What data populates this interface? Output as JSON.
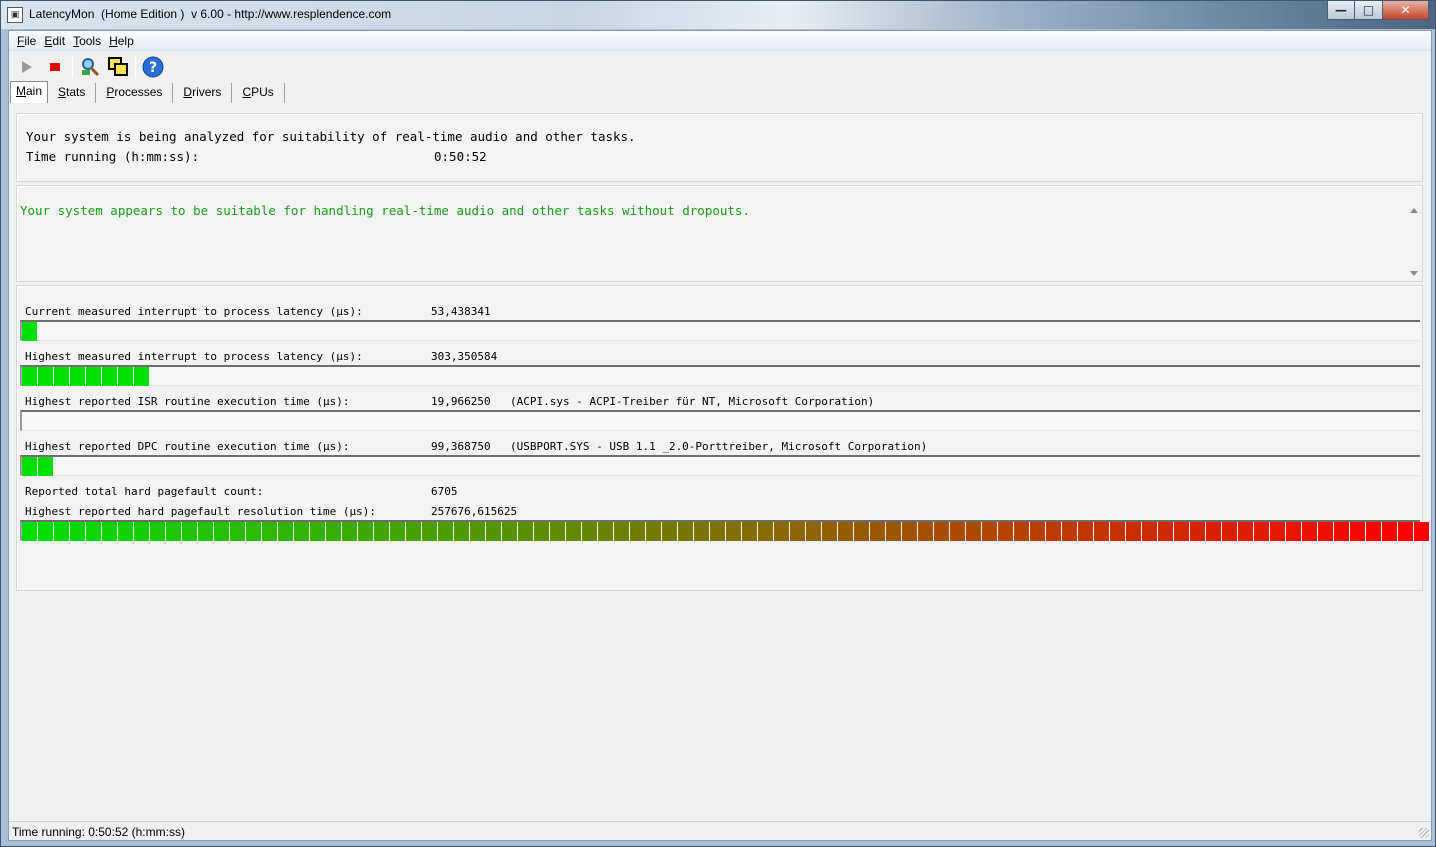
{
  "window": {
    "title": "LatencyMon  (Home Edition )  v 6.00 - http://www.resplendence.com",
    "minimize_glyph": "—",
    "maximize_glyph": "□",
    "close_glyph": "✕"
  },
  "menu": {
    "items": [
      {
        "label": "File",
        "accel": "F",
        "rest": "ile"
      },
      {
        "label": "Edit",
        "accel": "E",
        "rest": "dit"
      },
      {
        "label": "Tools",
        "accel": "T",
        "rest": "ools"
      },
      {
        "label": "Help",
        "accel": "H",
        "rest": "elp"
      }
    ]
  },
  "toolbar": {
    "icons": [
      "play-icon",
      "stop-icon",
      "search-icon",
      "windows-icon",
      "help-icon"
    ],
    "stop_color": "#e00000",
    "help_color": "#2a6fd6"
  },
  "tabs": [
    {
      "label": "Main",
      "accel": "M",
      "rest": "ain",
      "active": true
    },
    {
      "label": "Stats",
      "accel": "S",
      "rest": "tats",
      "active": false
    },
    {
      "label": "Processes",
      "accel": "P",
      "rest": "rocesses",
      "active": false
    },
    {
      "label": "Drivers",
      "accel": "D",
      "rest": "rivers",
      "active": false
    },
    {
      "label": "CPUs",
      "accel": "C",
      "rest": "PUs",
      "active": false
    }
  ],
  "summary": {
    "line1": "Your system is being analyzed for suitability of real-time audio and other tasks.",
    "time_label": "Time running (h:mm:ss):",
    "time_value": "0:50:52"
  },
  "verdict": {
    "message": "Your system appears to be suitable for handling real-time audio and other tasks without dropouts.",
    "color": "#1a9a1a"
  },
  "metrics": {
    "current_latency_label": "Current measured interrupt to process latency (µs):",
    "current_latency_value": "53,438341",
    "current_latency_bar_segments": 1,
    "highest_latency_label": "Highest measured interrupt to process latency (µs):",
    "highest_latency_value": "303,350584",
    "highest_latency_bar_segments": 8,
    "isr_label": "Highest reported ISR routine execution time (µs):",
    "isr_value": "19,966250",
    "isr_detail": "(ACPI.sys - ACPI-Treiber für NT, Microsoft Corporation)",
    "isr_bar_segments": 0,
    "dpc_label": "Highest reported DPC routine execution time (µs):",
    "dpc_value": "99,368750",
    "dpc_detail": "(USBPORT.SYS - USB 1.1 _2.0-Porttreiber, Microsoft Corporation)",
    "dpc_bar_segments": 2,
    "pagefault_count_label": "Reported total hard pagefault count:",
    "pagefault_count_value": "6705",
    "pagefault_time_label": "Highest reported hard pagefault resolution time (µs):",
    "pagefault_time_value": "257676,615625",
    "pagefault_bar_segments": 88,
    "total_segments": 88,
    "gradient_start": "#00e000",
    "gradient_end": "#ff0000"
  },
  "statusbar": {
    "text": "Time running: 0:50:52  (h:mm:ss)"
  }
}
